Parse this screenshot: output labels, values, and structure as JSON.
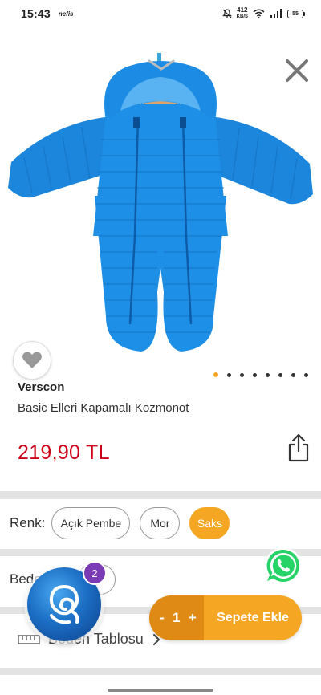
{
  "status_bar": {
    "time": "15:43",
    "app_indicator": "nefis",
    "net_speed": "412",
    "net_unit": "KB/S",
    "battery": "55"
  },
  "product": {
    "brand": "Verscon",
    "title": "Basic Elleri Kapamalı Kozmonot",
    "price": "219,90 TL",
    "image_color": "#1e8fe6",
    "gallery_dots": {
      "count": 8,
      "active_index": 0
    }
  },
  "color_option": {
    "label": "Renk:",
    "options": [
      "Açık Pembe",
      "Mor",
      "Saks"
    ],
    "selected": "Saks"
  },
  "size_option": {
    "label": "Beden",
    "chip": "ç"
  },
  "size_table": {
    "label": "Beden Tablosu",
    "icon": "ruler-icon"
  },
  "cart": {
    "minus": "-",
    "quantity": "1",
    "plus": "+",
    "add_label": "Sepete Ekle"
  },
  "assistant": {
    "badge": "2"
  },
  "colors": {
    "accent": "#f5a623",
    "accent_dark": "#e08a16",
    "price": "#d0021b",
    "whatsapp": "#25d366"
  }
}
